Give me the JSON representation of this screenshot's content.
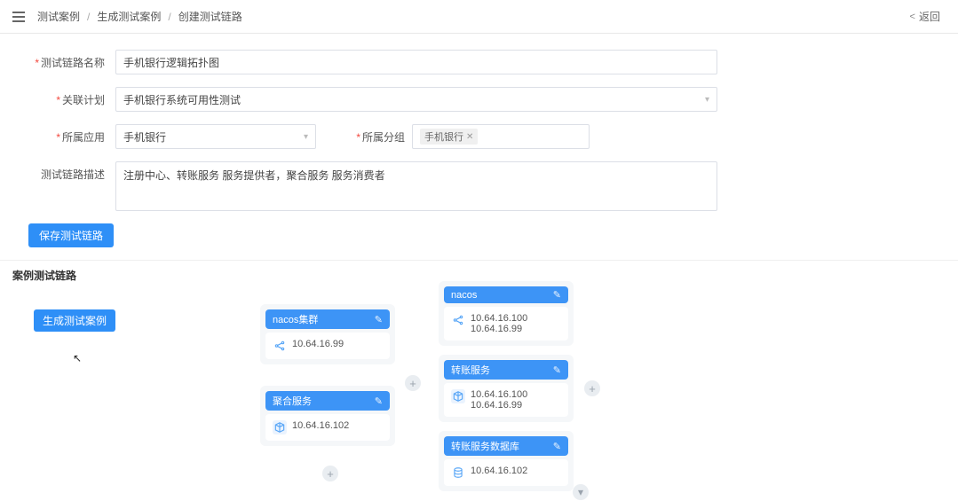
{
  "breadcrumb": {
    "a": "测试案例",
    "b": "生成测试案例",
    "c": "创建测试链路"
  },
  "back": "返回",
  "form": {
    "name_label": "测试链路名称",
    "name_value": "手机银行逻辑拓扑图",
    "plan_label": "关联计划",
    "plan_value": "手机银行系统可用性测试",
    "app_label": "所属应用",
    "app_value": "手机银行",
    "group_label": "所属分组",
    "group_tag": "手机银行",
    "desc_label": "测试链路描述",
    "desc_value": "注册中心、转账服务 服务提供者，聚合服务 服务消费者",
    "save": "保存测试链路"
  },
  "section": "案例测试链路",
  "gen_btn": "生成测试案例",
  "col1": [
    {
      "title": "nacos集群",
      "ips": [
        "10.64.16.99"
      ],
      "icon": "share"
    },
    {
      "title": "聚合服务",
      "ips": [
        "10.64.16.102"
      ],
      "icon": "cube"
    }
  ],
  "col2": [
    {
      "title": "nacos",
      "ips": [
        "10.64.16.100",
        "10.64.16.99"
      ],
      "icon": "share"
    },
    {
      "title": "转账服务",
      "ips": [
        "10.64.16.100",
        "10.64.16.99"
      ],
      "icon": "cube"
    },
    {
      "title": "转账服务数据库",
      "ips": [
        "10.64.16.102"
      ],
      "icon": "db"
    }
  ]
}
